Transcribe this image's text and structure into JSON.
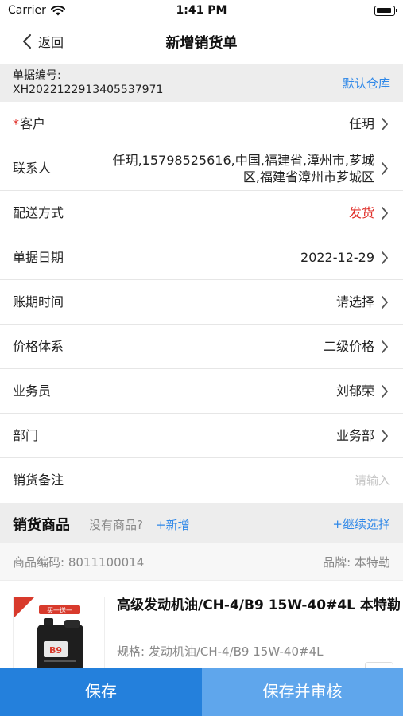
{
  "status": {
    "carrier": "Carrier",
    "time": "1:41 PM"
  },
  "nav": {
    "back_label": "返回",
    "title": "新增销货单"
  },
  "doc": {
    "number_label": "单据编号:",
    "number": "XH2022122913405537971",
    "warehouse": "默认仓库"
  },
  "fields": {
    "customer": {
      "required": "*",
      "label": "客户",
      "value": "任玥"
    },
    "contact": {
      "label": "联系人",
      "value_line1": "任玥,15798525616,中国,福建省,漳州市,芗城",
      "value_line2": "区,福建省漳州市芗城区"
    },
    "delivery": {
      "label": "配送方式",
      "value": "发货",
      "value_color": "#e0302a"
    },
    "date": {
      "label": "单据日期",
      "value": "2022-12-29"
    },
    "term": {
      "label": "账期时间",
      "value": "请选择"
    },
    "price": {
      "label": "价格体系",
      "value": "二级价格"
    },
    "salesperson": {
      "label": "业务员",
      "value": "刘郁荣"
    },
    "department": {
      "label": "部门",
      "value": "业务部"
    },
    "remark": {
      "label": "销货备注",
      "placeholder": "请输入"
    }
  },
  "goods": {
    "title": "销货商品",
    "none_text": "没有商品?",
    "add_label": "+新增",
    "continue_label": "+继续选择",
    "code_label": "商品编码: 8011100014",
    "brand_label": "品牌: 本特勒",
    "product_name": "高级发动机油/CH-4/B9 15W-40#4L 本特勒",
    "product_spec": "规格: 发动机油/CH-4/B9 15W-40#4L",
    "thumb_badge": "买一送一",
    "thumb_tag": "B9"
  },
  "footer": {
    "save_label": "保存",
    "save_audit_label": "保存并审核"
  },
  "colors": {
    "accent": "#2f88e8",
    "primary_button": "#2480dc",
    "secondary_button": "#5fa6ec",
    "required": "#e0302a"
  }
}
